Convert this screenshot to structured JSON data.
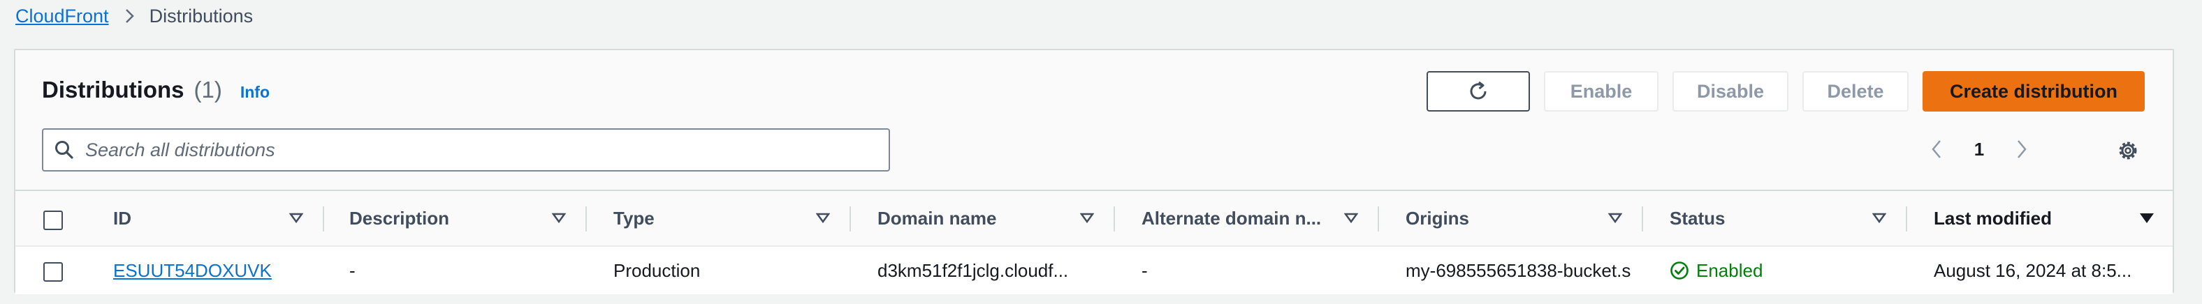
{
  "breadcrumb": {
    "root": "CloudFront",
    "current": "Distributions"
  },
  "panel": {
    "title": "Distributions",
    "count": "(1)",
    "info": "Info"
  },
  "actions": {
    "refresh_icon": "refresh-icon",
    "enable": "Enable",
    "disable": "Disable",
    "delete": "Delete",
    "create": "Create distribution"
  },
  "search": {
    "placeholder": "Search all distributions"
  },
  "pagination": {
    "current_page": "1"
  },
  "table": {
    "columns": {
      "id": "ID",
      "description": "Description",
      "type": "Type",
      "domain": "Domain name",
      "alternate": "Alternate domain n...",
      "origins": "Origins",
      "status": "Status",
      "last_modified": "Last modified"
    },
    "rows": [
      {
        "id": "ESUUT54DOXUVK",
        "description": "-",
        "type": "Production",
        "domain": "d3km51f2f1jclg.cloudf...",
        "alternate": "-",
        "origins": "my-698555651838-bucket.s",
        "status": "Enabled",
        "last_modified": "August 16, 2024 at 8:5..."
      }
    ]
  },
  "colors": {
    "link": "#0972d3",
    "primary": "#ec7211",
    "success": "#037f0c"
  }
}
